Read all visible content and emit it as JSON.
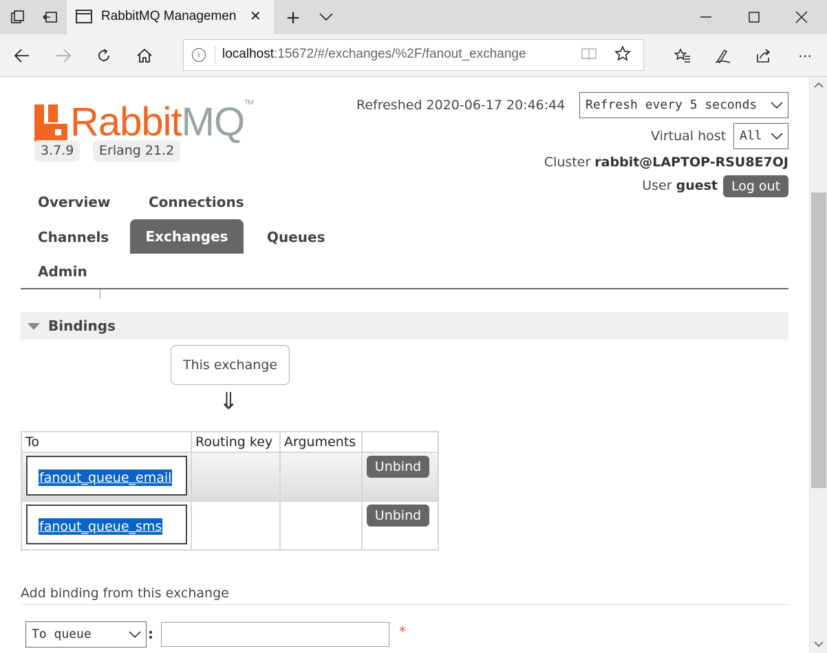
{
  "browser": {
    "tab_title": "RabbitMQ Managemen",
    "url_host": "localhost",
    "url_path": ":15672/#/exchanges/%2F/fanout_exchange"
  },
  "header": {
    "logo_rabbit": "Rabbit",
    "logo_mq": "MQ",
    "logo_tm": "TM",
    "version": "3.7.9",
    "erlang": "Erlang 21.2",
    "refreshed_label": "Refreshed 2020-06-17 20:46:44",
    "refresh_select": "Refresh every 5 seconds",
    "vhost_label": "Virtual host",
    "vhost_select": "All",
    "cluster_label": "Cluster",
    "cluster_name": "rabbit@LAPTOP-RSU8E7OJ",
    "user_label": "User",
    "user_name": "guest",
    "logout": "Log out"
  },
  "nav": {
    "overview": "Overview",
    "connections": "Connections",
    "channels": "Channels",
    "exchanges": "Exchanges",
    "queues": "Queues",
    "admin": "Admin"
  },
  "bindings": {
    "title": "Bindings",
    "this_exchange": "This exchange",
    "arrow": "⇓",
    "columns": [
      "To",
      "Routing key",
      "Arguments",
      ""
    ],
    "rows": [
      {
        "to": "fanout_queue_email",
        "routing_key": "",
        "arguments": "",
        "action": "Unbind"
      },
      {
        "to": "fanout_queue_sms",
        "routing_key": "",
        "arguments": "",
        "action": "Unbind"
      }
    ]
  },
  "add_binding": {
    "title": "Add binding from this exchange",
    "to_select": "To queue",
    "colon": ":",
    "destination_value": "",
    "required_mark": "*"
  }
}
